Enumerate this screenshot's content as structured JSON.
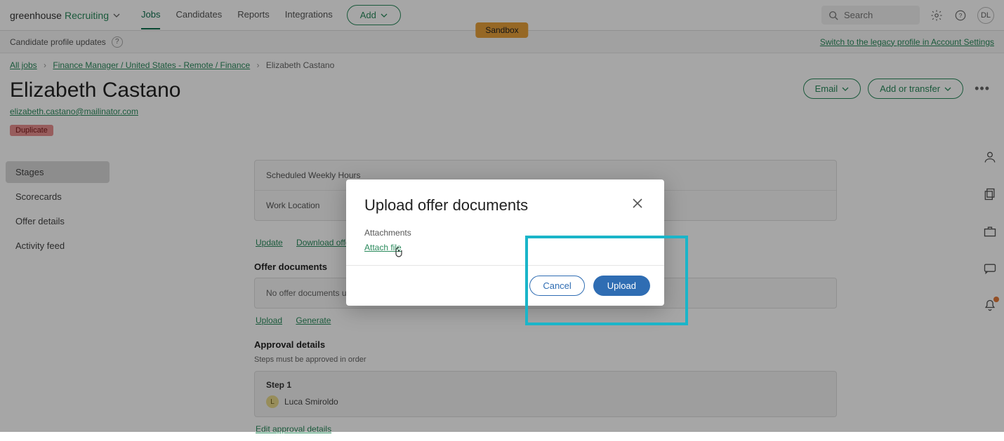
{
  "brand": {
    "name": "greenhouse",
    "product": "Recruiting"
  },
  "nav": {
    "items": [
      "Jobs",
      "Candidates",
      "Reports",
      "Integrations"
    ],
    "active": "Jobs",
    "add_label": "Add"
  },
  "sandbox_label": "Sandbox",
  "search": {
    "placeholder": "Search"
  },
  "user_initials": "DL",
  "banner": {
    "text": "Candidate profile updates",
    "legacy_link": "Switch to the legacy profile in Account Settings"
  },
  "breadcrumb": {
    "all_jobs": "All jobs",
    "job": "Finance Manager / United States - Remote / Finance",
    "candidate": "Elizabeth Castano"
  },
  "candidate": {
    "name": "Elizabeth Castano",
    "email": "elizabeth.castano@mailinator.com",
    "flag": "Duplicate"
  },
  "header_actions": {
    "email": "Email",
    "add_transfer": "Add or transfer"
  },
  "sidenav": {
    "items": [
      "Stages",
      "Scorecards",
      "Offer details",
      "Activity feed"
    ],
    "active": "Stages"
  },
  "detail_rows": {
    "hours": "Scheduled Weekly Hours",
    "location": "Work Location"
  },
  "link_row1": {
    "update": "Update",
    "download": "Download offer p"
  },
  "offer_docs": {
    "heading": "Offer documents",
    "empty": "No offer documents uplo"
  },
  "link_row2": {
    "upload": "Upload",
    "generate": "Generate"
  },
  "approval": {
    "heading": "Approval details",
    "note": "Steps must be approved in order",
    "step_label": "Step 1",
    "approver_initial": "L",
    "approver_name": "Luca Smiroldo",
    "edit": "Edit approval details"
  },
  "modal": {
    "title": "Upload offer documents",
    "attachments_label": "Attachments",
    "attach_link": "Attach file",
    "cancel": "Cancel",
    "upload": "Upload"
  }
}
